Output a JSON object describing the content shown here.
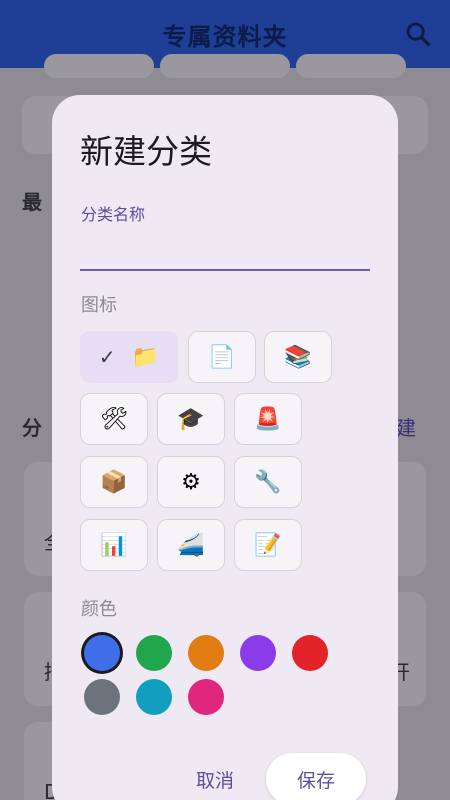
{
  "app": {
    "title": "专属资料夹",
    "background": {
      "recent_label": "最",
      "category_label": "分",
      "new_link": "建",
      "card_left_a": "全",
      "card_left_b": "招",
      "card_right_b": "开",
      "card_left_c": "D"
    }
  },
  "dialog": {
    "title": "新建分类",
    "name_field": {
      "label": "分类名称",
      "value": "",
      "placeholder": ""
    },
    "icon_section_label": "图标",
    "icons": [
      {
        "name": "folder-icon",
        "glyph": "📁",
        "selected": true,
        "selected_glyph": "✓"
      },
      {
        "name": "document-icon",
        "glyph": "📄",
        "selected": false
      },
      {
        "name": "books-icon",
        "glyph": "📚",
        "selected": false
      },
      {
        "name": "tools-icon",
        "glyph": "🛠",
        "selected": false
      },
      {
        "name": "graduation-cap-icon",
        "glyph": "🎓",
        "selected": false
      },
      {
        "name": "siren-icon",
        "glyph": "🚨",
        "selected": false
      },
      {
        "name": "package-icon",
        "glyph": "📦",
        "selected": false
      },
      {
        "name": "gear-icon",
        "glyph": "⚙",
        "selected": false
      },
      {
        "name": "wrench-icon",
        "glyph": "🔧",
        "selected": false
      },
      {
        "name": "bar-chart-icon",
        "glyph": "📊",
        "selected": false
      },
      {
        "name": "train-icon",
        "glyph": "🚄",
        "selected": false
      },
      {
        "name": "memo-icon",
        "glyph": "📝",
        "selected": false
      }
    ],
    "color_section_label": "颜色",
    "colors": [
      {
        "name": "blue",
        "hex": "#3f6fe8",
        "selected": true
      },
      {
        "name": "green",
        "hex": "#21a64e",
        "selected": false
      },
      {
        "name": "orange",
        "hex": "#e07c12",
        "selected": false
      },
      {
        "name": "purple",
        "hex": "#8b3ce8",
        "selected": false
      },
      {
        "name": "red",
        "hex": "#e2242a",
        "selected": false
      },
      {
        "name": "gray",
        "hex": "#6c737c",
        "selected": false
      },
      {
        "name": "teal",
        "hex": "#109fbf",
        "selected": false
      },
      {
        "name": "pink",
        "hex": "#e0267f",
        "selected": false
      }
    ],
    "cancel_label": "取消",
    "save_label": "保存"
  }
}
